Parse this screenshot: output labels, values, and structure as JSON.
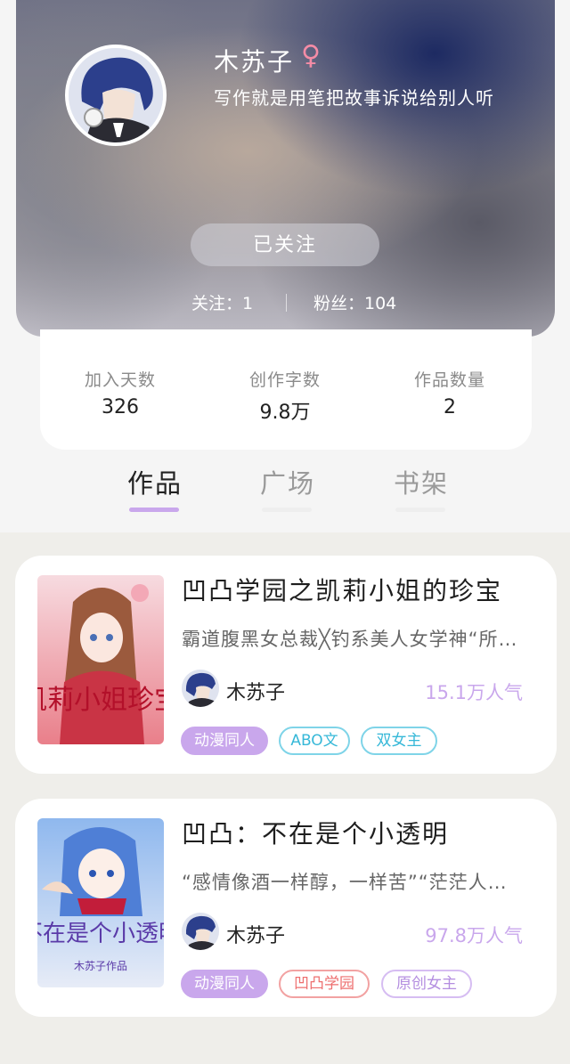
{
  "profile": {
    "name": "木苏子",
    "gender_icon": "♀",
    "bio": "写作就是用笔把故事诉说给别人听",
    "follow_button": "已关注",
    "following": "关注：1",
    "fans": "粉丝：104"
  },
  "stats": [
    {
      "label": "加入天数",
      "value": "326"
    },
    {
      "label": "创作字数",
      "value": "9.8万"
    },
    {
      "label": "作品数量",
      "value": "2"
    }
  ],
  "tabs": [
    {
      "label": "作品",
      "active": true
    },
    {
      "label": "广场",
      "active": false
    },
    {
      "label": "书架",
      "active": false
    }
  ],
  "books": [
    {
      "title": "凹凸学园之凯莉小姐的珍宝",
      "description": "霸道腹黑女总裁╳钓系美人女学神“所以，",
      "cover_text": "凯莉小姐珍宝",
      "author": "木苏子",
      "popularity": "15.1万人气",
      "tags": [
        "动漫同人",
        "ABO文",
        "双女主"
      ]
    },
    {
      "title": "凹凸：不在是个小透明",
      "description": "“感情像酒一样醇，一样苦”“茫茫人海中",
      "cover_text": "不在是个小透明",
      "cover_subtext": "木苏子作品",
      "author": "木苏子",
      "popularity": "97.8万人气",
      "tags": [
        "动漫同人",
        "凹凸学园",
        "原创女主"
      ]
    }
  ],
  "colors": {
    "accent": "#c9a7ec",
    "gender": "#f48ca6",
    "tag_cyan": "#36b8d8",
    "tag_red": "#ee6f6f"
  }
}
